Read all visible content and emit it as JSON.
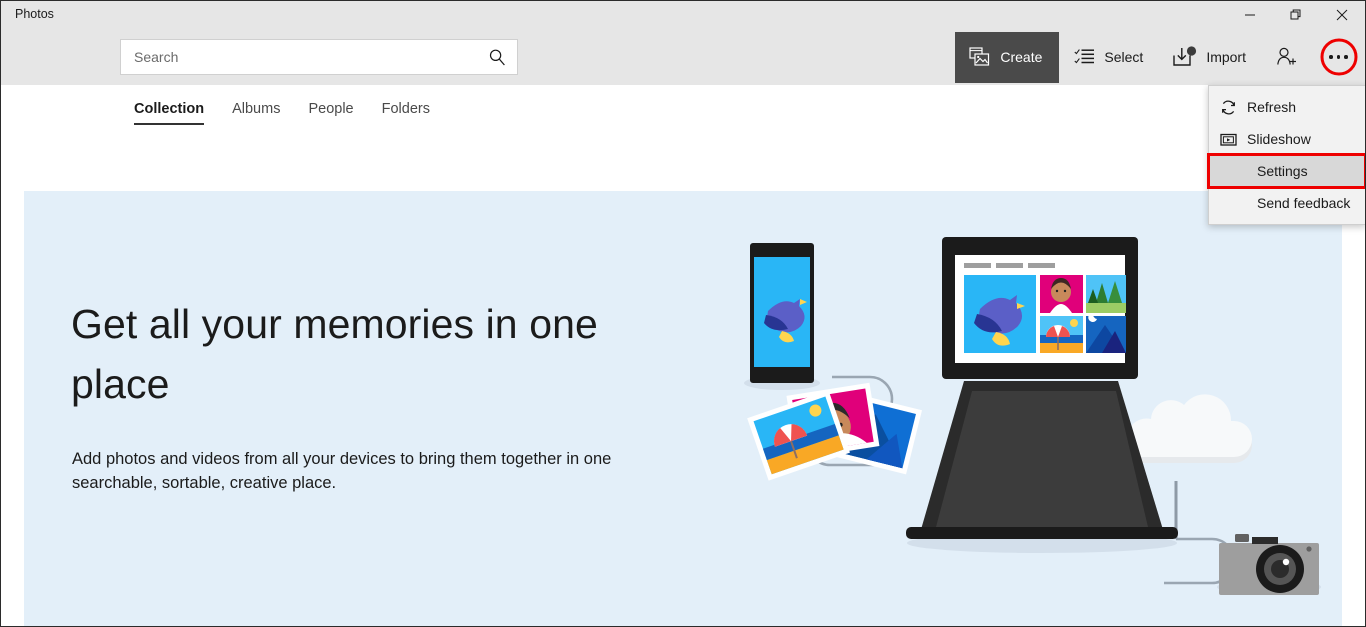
{
  "window": {
    "app_title": "Photos",
    "controls": [
      {
        "name": "minimize-button",
        "icon": "minimize-icon"
      },
      {
        "name": "restore-button",
        "icon": "restore-icon"
      },
      {
        "name": "close-button",
        "icon": "close-icon"
      }
    ]
  },
  "search": {
    "placeholder": "Search",
    "icon": "search-icon"
  },
  "toolbar": {
    "create_label": "Create",
    "select_label": "Select",
    "import_label": "Import",
    "add_people_icon": "add-person-icon",
    "more_icon": "ellipsis-icon",
    "create_bg": "#4a4a4a",
    "highlight_color": "#ee0000"
  },
  "tabs": [
    {
      "label": "Collection",
      "active": true
    },
    {
      "label": "Albums",
      "active": false
    },
    {
      "label": "People",
      "active": false
    },
    {
      "label": "Folders",
      "active": false
    }
  ],
  "hero": {
    "heading": "Get all your memories in one place",
    "body": "Add photos and videos from all your devices to bring them together in one searchable, sortable, creative place.",
    "bg_color": "#e3eff9"
  },
  "menu": {
    "items": [
      {
        "label": "Refresh",
        "icon": "refresh-icon",
        "selected": false
      },
      {
        "label": "Slideshow",
        "icon": "slideshow-icon",
        "selected": false
      },
      {
        "label": "Settings",
        "icon": "",
        "selected": true
      },
      {
        "label": "Send feedback",
        "icon": "",
        "selected": false
      }
    ]
  },
  "illustration": {
    "devices": [
      "phone",
      "laptop",
      "camera",
      "cloud",
      "photo-stack"
    ],
    "thumbnails": [
      "bird",
      "portrait",
      "forest",
      "beach-umbrella",
      "mountains-night"
    ]
  }
}
